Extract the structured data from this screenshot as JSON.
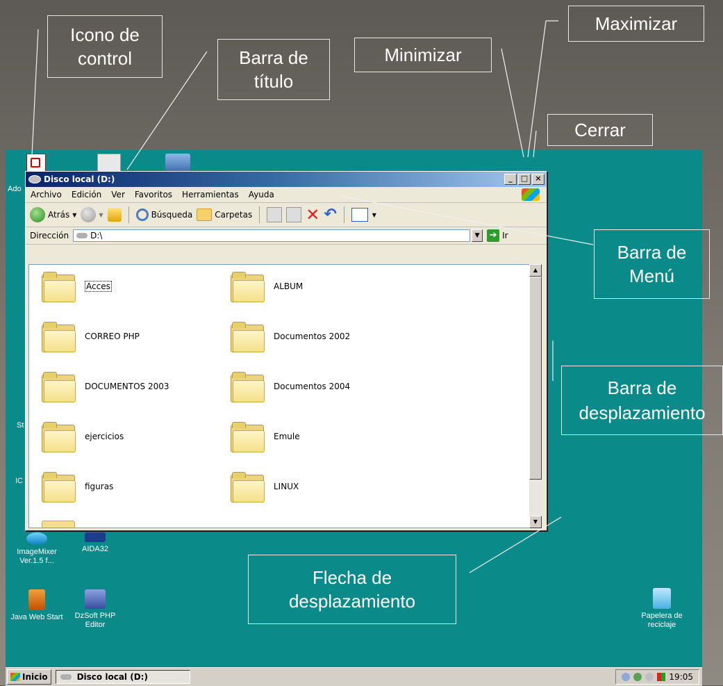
{
  "callouts": {
    "icono_control": "Icono de control",
    "barra_titulo": "Barra de título",
    "minimizar": "Minimizar",
    "maximizar": "Maximizar",
    "cerrar": "Cerrar",
    "barra_menu": "Barra de Menú",
    "barra_desplazamiento": "Barra de desplazamiento",
    "flecha_desplazamiento": "Flecha de desplazamiento"
  },
  "window": {
    "title": "Disco local (D:)",
    "minimize": "_",
    "maximize": "□",
    "close": "×"
  },
  "menu": [
    "Archivo",
    "Edición",
    "Ver",
    "Favoritos",
    "Herramientas",
    "Ayuda"
  ],
  "toolbar": {
    "back": "Atrás",
    "search": "Búsqueda",
    "folders": "Carpetas"
  },
  "address": {
    "label": "Dirección",
    "value": "D:\\",
    "go": "Ir"
  },
  "folders": [
    "Acces",
    "ALBUM",
    "CORREO PHP",
    "Documentos 2002",
    "DOCUMENTOS 2003",
    "Documentos 2004",
    "ejercicios",
    "Emule",
    "figuras",
    "LINUX"
  ],
  "desktop_icons": {
    "imagemixer": "ImageMixer Ver.1.5 f...",
    "aida": "AIDA32",
    "javaws": "Java Web Start",
    "dzsoft": "DzSoft PHP Editor",
    "recycle": "Papelera de reciclaje",
    "partial_ado": "Ado",
    "partial_st": "St",
    "partial_ic": "IC"
  },
  "taskbar": {
    "start": "Inicio",
    "task": "Disco local (D:)",
    "clock": "19:05"
  }
}
